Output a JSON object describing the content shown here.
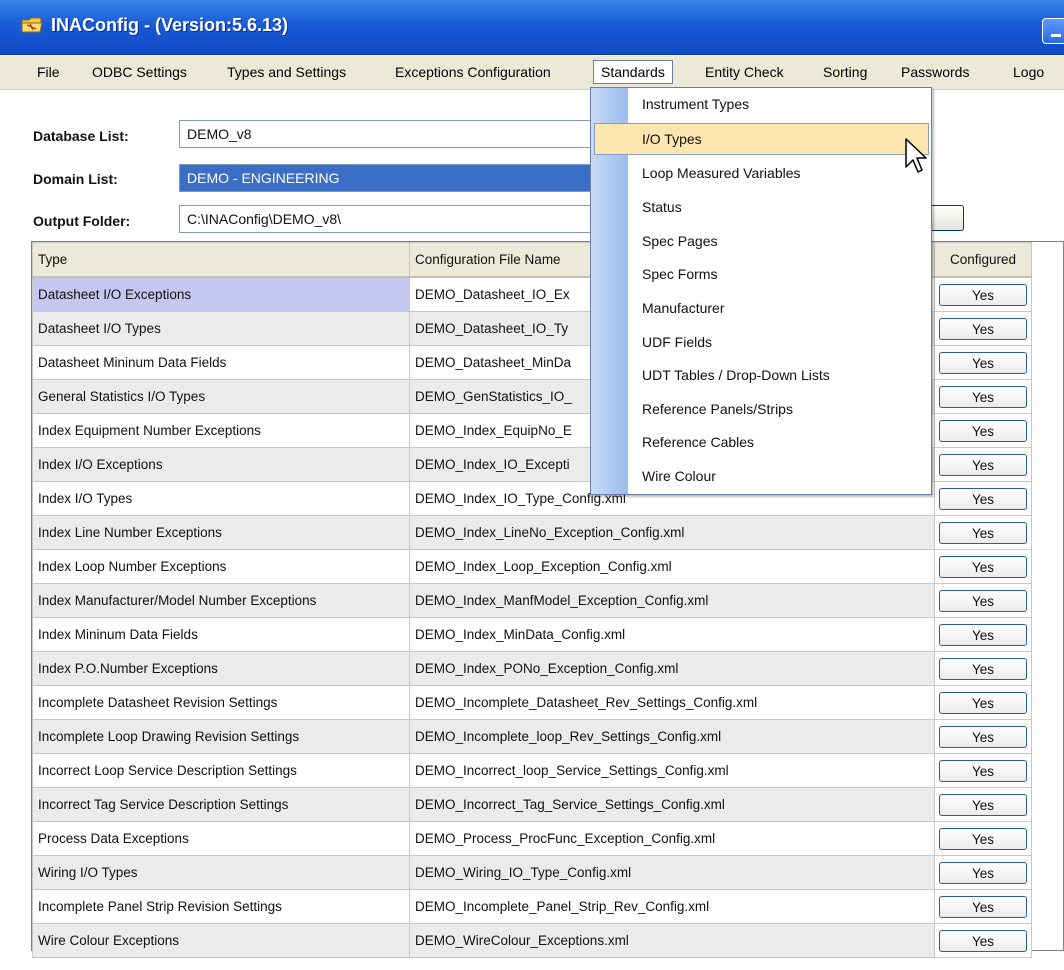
{
  "window": {
    "title": "INAConfig - (Version:5.6.13)"
  },
  "menu": {
    "items": [
      "File",
      "ODBC Settings",
      "Types and Settings",
      "Exceptions Configuration",
      "Standards",
      "Entity Check",
      "Sorting",
      "Passwords",
      "Logo"
    ],
    "active": "Standards"
  },
  "form": {
    "database_label": "Database List:",
    "database_value": "DEMO_v8",
    "domain_label": "Domain List:",
    "domain_value": "DEMO - ENGINEERING",
    "output_label": "Output Folder:",
    "output_value": "C:\\INAConfig\\DEMO_v8\\"
  },
  "table": {
    "headers": [
      "Type",
      "Configuration File Name",
      "Configured"
    ],
    "rows": [
      {
        "type": "Datasheet I/O Exceptions",
        "file": "DEMO_Datasheet_IO_Ex",
        "configured": "Yes"
      },
      {
        "type": "Datasheet I/O Types",
        "file": "DEMO_Datasheet_IO_Ty",
        "configured": "Yes"
      },
      {
        "type": "Datasheet Mininum Data Fields",
        "file": "DEMO_Datasheet_MinDa",
        "configured": "Yes"
      },
      {
        "type": "General Statistics I/O Types",
        "file": "DEMO_GenStatistics_IO_",
        "configured": "Yes"
      },
      {
        "type": "Index Equipment Number Exceptions",
        "file": "DEMO_Index_EquipNo_E",
        "configured": "Yes"
      },
      {
        "type": "Index I/O Exceptions",
        "file": "DEMO_Index_IO_Excepti",
        "configured": "Yes"
      },
      {
        "type": "Index I/O Types",
        "file": "DEMO_Index_IO_Type_Config.xml",
        "configured": "Yes"
      },
      {
        "type": "Index Line Number Exceptions",
        "file": "DEMO_Index_LineNo_Exception_Config.xml",
        "configured": "Yes"
      },
      {
        "type": "Index Loop Number Exceptions",
        "file": "DEMO_Index_Loop_Exception_Config.xml",
        "configured": "Yes"
      },
      {
        "type": "Index Manufacturer/Model Number Exceptions",
        "file": "DEMO_Index_ManfModel_Exception_Config.xml",
        "configured": "Yes"
      },
      {
        "type": "Index Mininum Data Fields",
        "file": "DEMO_Index_MinData_Config.xml",
        "configured": "Yes"
      },
      {
        "type": "Index P.O.Number Exceptions",
        "file": "DEMO_Index_PONo_Exception_Config.xml",
        "configured": "Yes"
      },
      {
        "type": "Incomplete Datasheet Revision Settings",
        "file": "DEMO_Incomplete_Datasheet_Rev_Settings_Config.xml",
        "configured": "Yes"
      },
      {
        "type": "Incomplete Loop Drawing Revision Settings",
        "file": "DEMO_Incomplete_loop_Rev_Settings_Config.xml",
        "configured": "Yes"
      },
      {
        "type": "Incorrect Loop Service Description Settings",
        "file": "DEMO_Incorrect_loop_Service_Settings_Config.xml",
        "configured": "Yes"
      },
      {
        "type": "Incorrect Tag Service Description Settings",
        "file": "DEMO_Incorrect_Tag_Service_Settings_Config.xml",
        "configured": "Yes"
      },
      {
        "type": "Process Data Exceptions",
        "file": "DEMO_Process_ProcFunc_Exception_Config.xml",
        "configured": "Yes"
      },
      {
        "type": "Wiring I/O Types",
        "file": "DEMO_Wiring_IO_Type_Config.xml",
        "configured": "Yes"
      },
      {
        "type": "Incomplete Panel Strip Revision Settings",
        "file": "DEMO_Incomplete_Panel_Strip_Rev_Config.xml",
        "configured": "Yes"
      },
      {
        "type": "Wire Colour Exceptions",
        "file": "DEMO_WireColour_Exceptions.xml",
        "configured": "Yes"
      }
    ]
  },
  "dropdown": {
    "items": [
      "Instrument Types",
      "I/O Types",
      "Loop Measured Variables",
      "Status",
      "Spec Pages",
      "Spec Forms",
      "Manufacturer",
      "UDF Fields",
      "UDT Tables / Drop-Down Lists",
      "Reference Panels/Strips",
      "Reference Cables",
      "Wire Colour"
    ],
    "highlighted": "I/O Types"
  },
  "colors": {
    "titlebar": "#1a5ad8",
    "menubar": "#ece9d8",
    "domain_selected": "#3a6fc5",
    "selected_row": "#c4c8f0",
    "menu_highlight": "#fde6b0"
  },
  "icons": {
    "app": "folder-app-icon",
    "minimize": "minimize-icon",
    "cursor": "pointer-cursor-icon"
  }
}
